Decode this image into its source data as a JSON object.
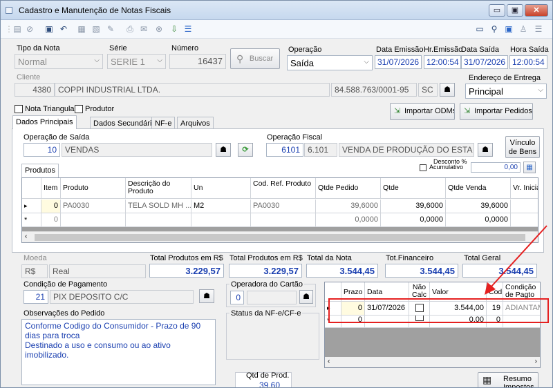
{
  "window": {
    "title": "Cadastro e Manutenção de Notas Fiscais",
    "min": "▭",
    "max": "▣",
    "close": "✕"
  },
  "header": {
    "tipo_label": "Tipo da Nota",
    "tipo_value": "Normal",
    "serie_label": "Série",
    "serie_value": "SERIE 1",
    "numero_label": "Número",
    "numero_value": "16437",
    "buscar": "Buscar",
    "operacao_label": "Operação",
    "operacao_value": "Saída",
    "data_emissao_label": "Data Emissão",
    "data_emissao_value": "31/07/2026",
    "hr_emissao_label": "Hr.Emissão",
    "hr_emissao_value": "12:00:54",
    "data_saida_label": "Data Saída",
    "data_saida_value": "31/07/2026",
    "hora_saida_label": "Hora Saída",
    "hora_saida_value": "12:00:54",
    "cliente_label": "Cliente",
    "cliente_code": "4380",
    "cliente_name": "COPPI INDUSTRIAL LTDA.",
    "cnpj": "84.588.763/0001-95",
    "uf": "SC",
    "endereco_label": "Endereço de Entrega",
    "endereco_value": "Principal",
    "nota_triangular": "Nota Triangular",
    "produtor": "Produtor",
    "importar_odms": "Importar ODMs",
    "importar_pedidos": "Importar Pedidos"
  },
  "tabs": [
    "Dados Principais",
    "Dados Secundários",
    "NF-e",
    "Arquivos"
  ],
  "operacao_saida": {
    "label": "Operação de Saída",
    "code": "10",
    "name": "VENDAS"
  },
  "operacao_fiscal": {
    "label": "Operação Fiscal",
    "cfop": "6101",
    "cfop2": "6.101",
    "desc": "VENDA DE PRODUÇÃO DO ESTA"
  },
  "vinculo_bens": "Vínculo de Bens",
  "produtos_tab": "Produtos",
  "desconto": {
    "label": "Desconto %",
    "acumulativo": "Acumulativo",
    "value": "0,00"
  },
  "produtos_grid": {
    "headers": [
      "Item",
      "Produto",
      "Descrição do Produto",
      "Un",
      "Cod. Ref. Produto",
      "Qtde Pedido",
      "Qtde",
      "Qtde Venda",
      "Vr. Inicia"
    ],
    "rows": [
      {
        "marker": "▸",
        "item": "0",
        "produto": "PA0030",
        "descricao": "TELA SOLD MH ...",
        "un": "M2",
        "codref": "PA0030",
        "qtde_pedido": "39,6000",
        "qtde": "39,6000",
        "qtde_venda": "39,6000",
        "vr": ""
      },
      {
        "marker": "*",
        "item": "0",
        "produto": "",
        "descricao": "",
        "un": "",
        "codref": "",
        "qtde_pedido": "0,0000",
        "qtde": "0,0000",
        "qtde_venda": "0,0000",
        "vr": ""
      }
    ]
  },
  "moeda": {
    "label": "Moeda",
    "symbol": "R$",
    "name": "Real"
  },
  "totals": [
    {
      "label": "Total Produtos em R$",
      "value": "3.229,57"
    },
    {
      "label": "Total Produtos em R$",
      "value": "3.229,57"
    },
    {
      "label": "Total da Nota",
      "value": "3.544,45"
    },
    {
      "label": "Tot.Financeiro",
      "value": "3.544,45"
    },
    {
      "label": "Total Geral",
      "value": "3.544,45"
    }
  ],
  "condicao": {
    "label": "Condição de Pagamento",
    "code": "21",
    "name": "PIX DEPOSITO C/C"
  },
  "operadora": {
    "label": "Operadora do Cartão",
    "code": "0"
  },
  "observacoes": {
    "label": "Observações do Pedido",
    "text": "Conforme Codigo do Consumidor - Prazo de 90 dias para troca\nDestinado a uso e consumo ou ao ativo imobilizado."
  },
  "status_label": "Status da NF-e/CF-e",
  "pagamento_grid": {
    "headers": [
      "Prazo",
      "Data",
      "Não Calc",
      "Valor",
      "Cod.",
      "Condição de Pagto"
    ],
    "rows": [
      {
        "marker": "▸",
        "prazo": "0",
        "data": "31/07/2026",
        "valor": "3.544,00",
        "cod": "19",
        "cond": "ADIANTAM"
      },
      {
        "marker": "*",
        "prazo": "0",
        "data": "",
        "valor": "0,00",
        "cod": "0",
        "cond": ""
      }
    ]
  },
  "qtd_prod": {
    "label": "Qtd de Prod.",
    "value": "39,60"
  },
  "resumo": "Resumo Impostos",
  "accent": "#1a3fb0",
  "highlight": "#e52020"
}
